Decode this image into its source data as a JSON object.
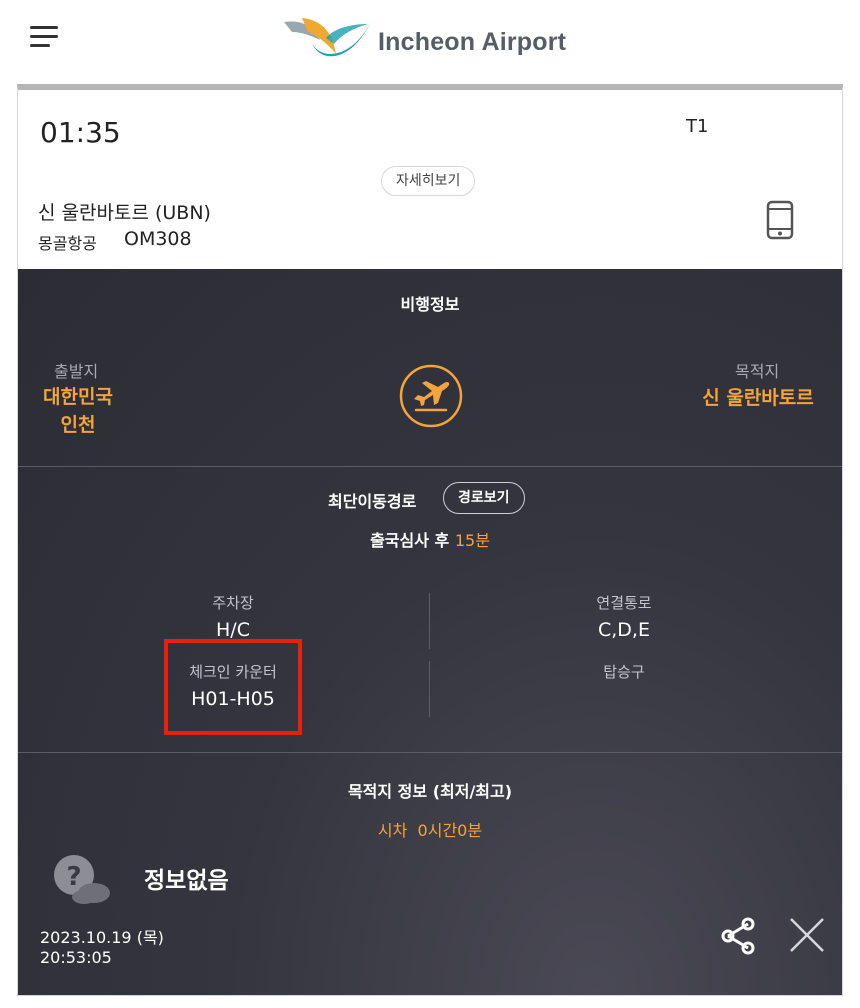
{
  "header": {
    "logo_text": "Incheon Airport",
    "menu_icon": "hamburger-menu-icon",
    "logo_icon": "incheon-airport-logo-icon"
  },
  "flight": {
    "time": "01:35",
    "terminal": "T1",
    "detail_label": "자세히보기",
    "destination": "신 울란바토르 (UBN)",
    "airline": "몽골항공",
    "flight_no": "OM308",
    "phone_icon": "mobile-phone-icon"
  },
  "flight_info": {
    "title": "비행정보",
    "origin_label": "출발지",
    "origin_line1": "대한민국",
    "origin_line2": "인천",
    "destination_label": "목적지",
    "destination_value": "신 울란바토르",
    "plane_icon": "departure-plane-icon"
  },
  "route": {
    "title": "최단이동경로",
    "button_label": "경로보기",
    "text_prefix": "출국심사 후 ",
    "text_accent": "15분"
  },
  "facilities": {
    "parking_label": "주차장",
    "parking_value": "H/C",
    "connection_label": "연결통로",
    "connection_value": "C,D,E",
    "checkin_label": "체크인 카운터",
    "checkin_value": "H01-H05",
    "gate_label": "탑승구",
    "gate_value": ""
  },
  "destination_info": {
    "title": "목적지 정보 (최저/최고)",
    "time_diff_label": "시차",
    "time_diff_value": "0시간0분",
    "weather_text": "정보없음",
    "weather_icon": "unknown-weather-icon",
    "date": "2023.10.19 (목)",
    "time": "20:53:05",
    "share_icon": "share-icon",
    "close_icon": "close-icon"
  },
  "colors": {
    "accent": "#f3a43a",
    "dark_bg": "#34343e",
    "highlight": "#e8210f"
  }
}
